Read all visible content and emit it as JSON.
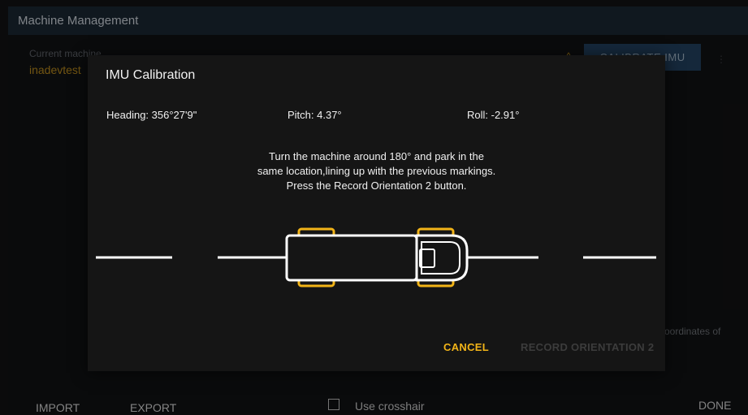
{
  "appbar": {
    "title": "Machine Management"
  },
  "background": {
    "current_machine_label": "Current machine",
    "current_machine_value": "inadevtest",
    "caret_icon": "chevron-up-icon",
    "calibrate_button": "CALIBRATE IMU",
    "more_icon": "more-vert-icon",
    "partial_text": "oordinates of"
  },
  "dialog": {
    "title": "IMU Calibration",
    "heading": "Heading: 356°27'9\"",
    "pitch": "Pitch: 4.37°",
    "roll": "Roll: -2.91°",
    "instructions": [
      "Turn the machine around 180° and park in the",
      "same location,lining up with the previous markings.",
      "Press the Record Orientation 2 button."
    ],
    "cancel_label": "CANCEL",
    "record_label": "RECORD ORIENTATION 2"
  },
  "bottom_bar": {
    "import_label": "IMPORT",
    "export_label": "EXPORT",
    "crosshair_label": "Use crosshair",
    "crosshair_checked": false,
    "done_label": "DONE"
  },
  "colors": {
    "accent": "#f2b418",
    "appbar": "#1b2733",
    "dialog_bg": "#151515",
    "disabled": "#3c3c3c"
  }
}
